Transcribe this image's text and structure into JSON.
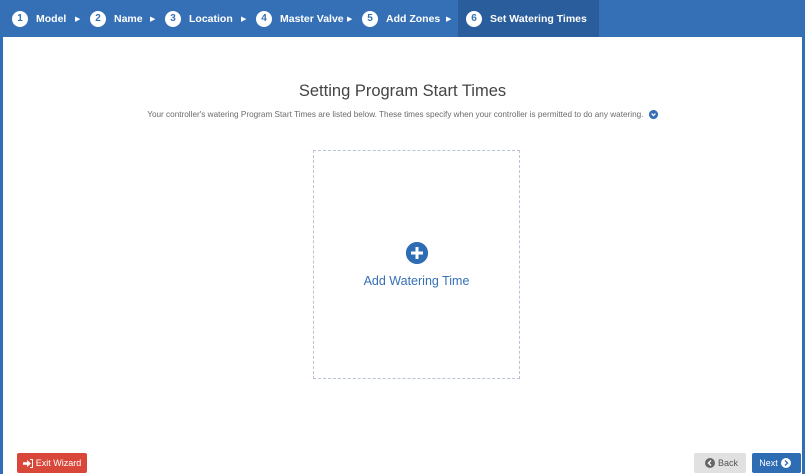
{
  "wizard": {
    "steps": [
      {
        "num": "1",
        "label": "Model"
      },
      {
        "num": "2",
        "label": "Name"
      },
      {
        "num": "3",
        "label": "Location"
      },
      {
        "num": "4",
        "label": "Master Valve"
      },
      {
        "num": "5",
        "label": "Add Zones"
      },
      {
        "num": "6",
        "label": "Set Watering Times"
      }
    ],
    "active_step": 6
  },
  "main": {
    "title": "Setting Program Start Times",
    "description": "Your controller's watering Program Start Times are listed below. These times specify when your controller is permitted to do any watering.",
    "add_label": "Add Watering Time"
  },
  "footer": {
    "exit_label": "Exit Wizard",
    "back_label": "Back",
    "next_label": "Next"
  },
  "colors": {
    "primary": "#3570b6",
    "danger": "#d9473b"
  }
}
